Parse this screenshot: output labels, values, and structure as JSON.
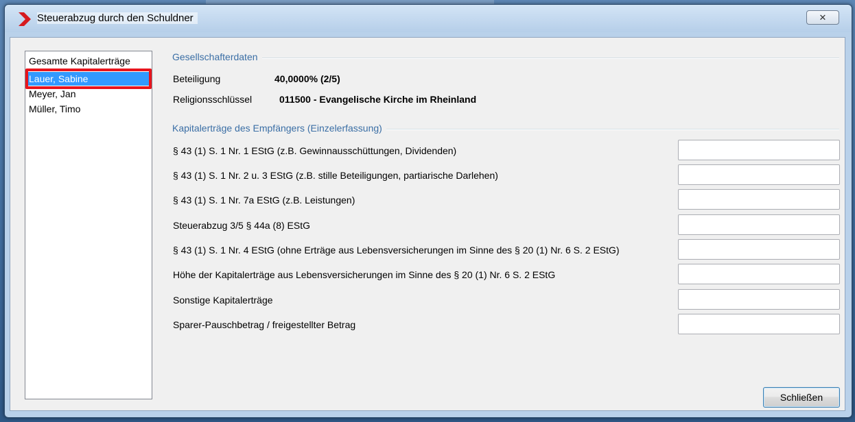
{
  "window": {
    "title": "Steuerabzug durch den Schuldner",
    "close_glyph": "✕",
    "icon": "red-chevron-icon"
  },
  "sidebar": {
    "items": [
      {
        "label": "Gesamte Kapitalerträge",
        "selected": false
      },
      {
        "label": "Lauer, Sabine",
        "selected": true
      },
      {
        "label": "Meyer, Jan",
        "selected": false
      },
      {
        "label": "Müller, Timo",
        "selected": false
      }
    ]
  },
  "shareholder": {
    "section_title": "Gesellschafterdaten",
    "stake_label": "Beteiligung",
    "stake_value": "40,0000%  (2/5)",
    "religion_label": "Religionsschlüssel",
    "religion_value": "011500 - Evangelische Kirche im Rheinland"
  },
  "income": {
    "section_title": "Kapitalerträge des Empfängers (Einzelerfassung)",
    "rows": [
      {
        "label": "§ 43 (1) S. 1 Nr. 1 EStG (z.B. Gewinnausschüttungen, Dividenden)",
        "value": ""
      },
      {
        "label": "§ 43 (1) S. 1 Nr. 2 u. 3 EStG (z.B. stille Beteiligungen, partiarische Darlehen)",
        "value": ""
      },
      {
        "label": "§ 43 (1) S. 1 Nr. 7a EStG (z.B. Leistungen)",
        "value": ""
      },
      {
        "label": "Steuerabzug 3/5 § 44a (8) EStG",
        "value": ""
      },
      {
        "label": "§ 43 (1) S. 1 Nr. 4 EStG (ohne Erträge aus Lebensversicherungen im Sinne des § 20 (1) Nr. 6 S. 2 EStG)",
        "value": ""
      },
      {
        "label": "Höhe der Kapitalerträge aus Lebensversicherungen im Sinne des § 20 (1) Nr. 6 S. 2 EStG",
        "value": ""
      },
      {
        "label": "Sonstige Kapitalerträge",
        "value": ""
      },
      {
        "label": "Sparer-Pauschbetrag / freigestellter Betrag",
        "value": ""
      }
    ]
  },
  "footer": {
    "close_label": "Schließen"
  },
  "colors": {
    "selection": "#3399ff",
    "highlight_outline": "#e8141c",
    "section_title": "#3a6ea5"
  }
}
